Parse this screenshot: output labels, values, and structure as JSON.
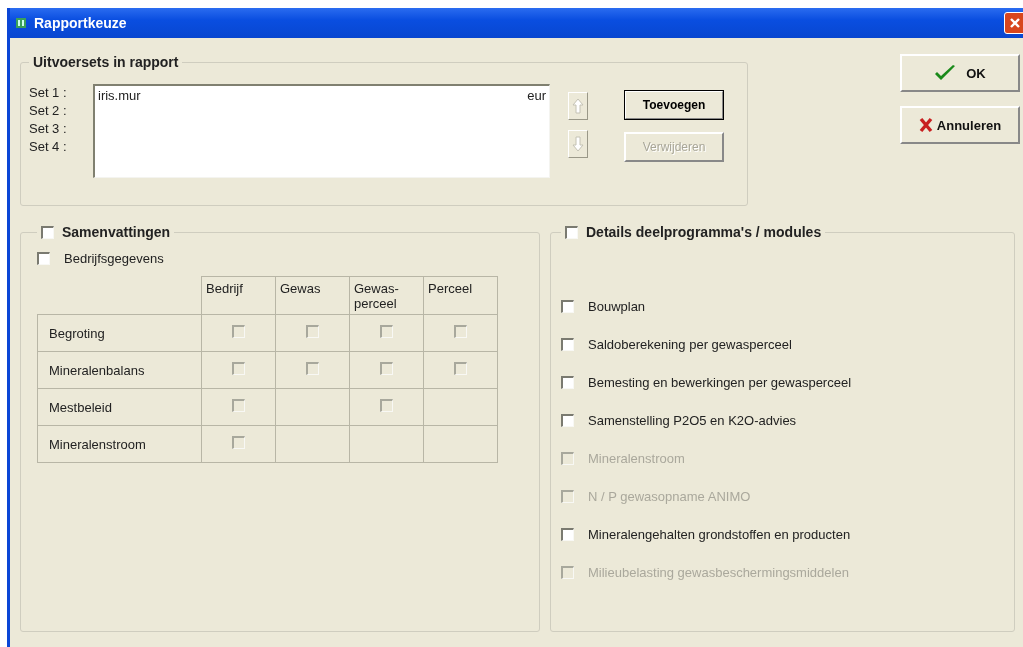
{
  "window": {
    "title": "Rapportkeuze"
  },
  "output_sets": {
    "title": "Uitvoersets in rapport",
    "labels": [
      "Set 1 :",
      "Set 2 :",
      "Set 3 :",
      "Set 4 :"
    ],
    "entries": [
      {
        "name": "iris.mur",
        "unit": "eur",
        "selected": false
      }
    ],
    "move_buttons": [
      {
        "kind": "up",
        "disabled": true
      },
      {
        "kind": "down",
        "disabled": true
      }
    ],
    "buttons": [
      {
        "label": "Toevoegen",
        "disabled": false,
        "default": true
      },
      {
        "label": "Verwijderen",
        "disabled": true,
        "default": false
      }
    ]
  },
  "dialog_buttons": [
    {
      "kind": "ok",
      "label": "OK"
    },
    {
      "kind": "cancel",
      "label": "Annuleren"
    }
  ],
  "summaries": {
    "title": "Samenvattingen",
    "checked": false,
    "company_data": {
      "label": "Bedrijfsgegevens",
      "checked": false
    },
    "columns": [
      "Bedrijf",
      "Gewas",
      "Gewas-perceel",
      "Perceel"
    ],
    "rows": [
      {
        "label": "Begroting",
        "cells": [
          {
            "kind": "checkbox",
            "checked": false,
            "disabled": true
          },
          {
            "kind": "checkbox",
            "checked": false,
            "disabled": true
          },
          {
            "kind": "checkbox",
            "checked": false,
            "disabled": true
          },
          {
            "kind": "checkbox",
            "checked": false,
            "disabled": true
          }
        ]
      },
      {
        "label": "Mineralenbalans",
        "cells": [
          {
            "kind": "checkbox",
            "checked": false,
            "disabled": true
          },
          {
            "kind": "checkbox",
            "checked": false,
            "disabled": true
          },
          {
            "kind": "checkbox",
            "checked": false,
            "disabled": true
          },
          {
            "kind": "checkbox",
            "checked": false,
            "disabled": true
          }
        ]
      },
      {
        "label": "Mestbeleid",
        "cells": [
          {
            "kind": "checkbox",
            "checked": false,
            "disabled": true
          },
          {
            "kind": "empty"
          },
          {
            "kind": "checkbox",
            "checked": false,
            "disabled": true
          },
          {
            "kind": "empty"
          }
        ]
      },
      {
        "label": "Mineralenstroom",
        "cells": [
          {
            "kind": "checkbox",
            "checked": false,
            "disabled": true
          },
          {
            "kind": "empty"
          },
          {
            "kind": "empty"
          },
          {
            "kind": "empty"
          }
        ]
      }
    ]
  },
  "details": {
    "title": "Details deelprogramma's / modules",
    "checked": false,
    "items": [
      {
        "label": "Bouwplan",
        "checked": false,
        "disabled": false
      },
      {
        "label": "Saldoberekening per gewasperceel",
        "checked": false,
        "disabled": false
      },
      {
        "label": "Bemesting en bewerkingen per gewasperceel",
        "checked": false,
        "disabled": false
      },
      {
        "label": "Samenstelling P2O5 en K2O-advies",
        "checked": false,
        "disabled": false
      },
      {
        "label": "Mineralenstroom",
        "checked": false,
        "disabled": true
      },
      {
        "label": "N / P gewasopname ANIMO",
        "checked": false,
        "disabled": true
      },
      {
        "label": "Mineralengehalten grondstoffen en producten",
        "checked": false,
        "disabled": false
      },
      {
        "label": "Milieubelasting gewasbeschermingsmiddelen",
        "checked": false,
        "disabled": true
      }
    ]
  }
}
